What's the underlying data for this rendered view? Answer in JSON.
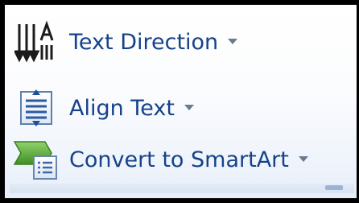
{
  "menu": {
    "items": [
      {
        "label": "Text Direction",
        "icon": "text-direction-icon"
      },
      {
        "label": "Align Text",
        "icon": "align-text-icon"
      },
      {
        "label": "Convert to SmartArt",
        "icon": "convert-smartart-icon"
      }
    ]
  },
  "colors": {
    "label": "#15428b",
    "frame": "#000000",
    "caret": "#6b7a90",
    "smartart_green": "#5aa63a"
  }
}
